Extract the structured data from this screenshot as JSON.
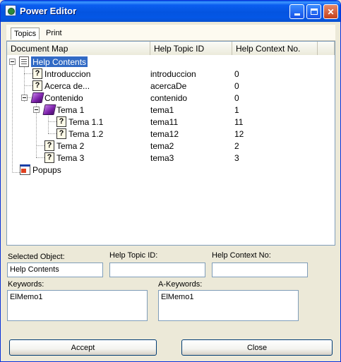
{
  "window": {
    "title": "Power Editor"
  },
  "tabs": [
    {
      "label": "Topics"
    },
    {
      "label": "Print"
    }
  ],
  "columns": [
    "Document Map",
    "Help Topic ID",
    "Help Context No."
  ],
  "tree": {
    "root": {
      "label": "Help Contents"
    },
    "nodes": [
      {
        "label": "Introduccion",
        "topic_id": "introduccion",
        "context_no": "0"
      },
      {
        "label": "Acerca de...",
        "topic_id": "acercaDe",
        "context_no": "0"
      },
      {
        "label": "Contenido",
        "topic_id": "contenido",
        "context_no": "0"
      },
      {
        "label": "Tema 1",
        "topic_id": "tema1",
        "context_no": "1"
      },
      {
        "label": "Tema 1.1",
        "topic_id": "tema11",
        "context_no": "11"
      },
      {
        "label": "Tema 1.2",
        "topic_id": "tema12",
        "context_no": "12"
      },
      {
        "label": "Tema 2",
        "topic_id": "tema2",
        "context_no": "2"
      },
      {
        "label": "Tema 3",
        "topic_id": "tema3",
        "context_no": "3"
      }
    ],
    "popups": {
      "label": "Popups"
    }
  },
  "form": {
    "selected_object": {
      "label": "Selected Object:",
      "value": "Help Contents"
    },
    "help_topic_id": {
      "label": "Help Topic ID:",
      "value": ""
    },
    "help_context_no": {
      "label": "Help Context No:",
      "value": ""
    },
    "keywords": {
      "label": "Keywords:",
      "value": "ElMemo1"
    },
    "a_keywords": {
      "label": "A-Keywords:",
      "value": "ElMemo1"
    }
  },
  "buttons": {
    "accept": "Accept",
    "close": "Close"
  }
}
